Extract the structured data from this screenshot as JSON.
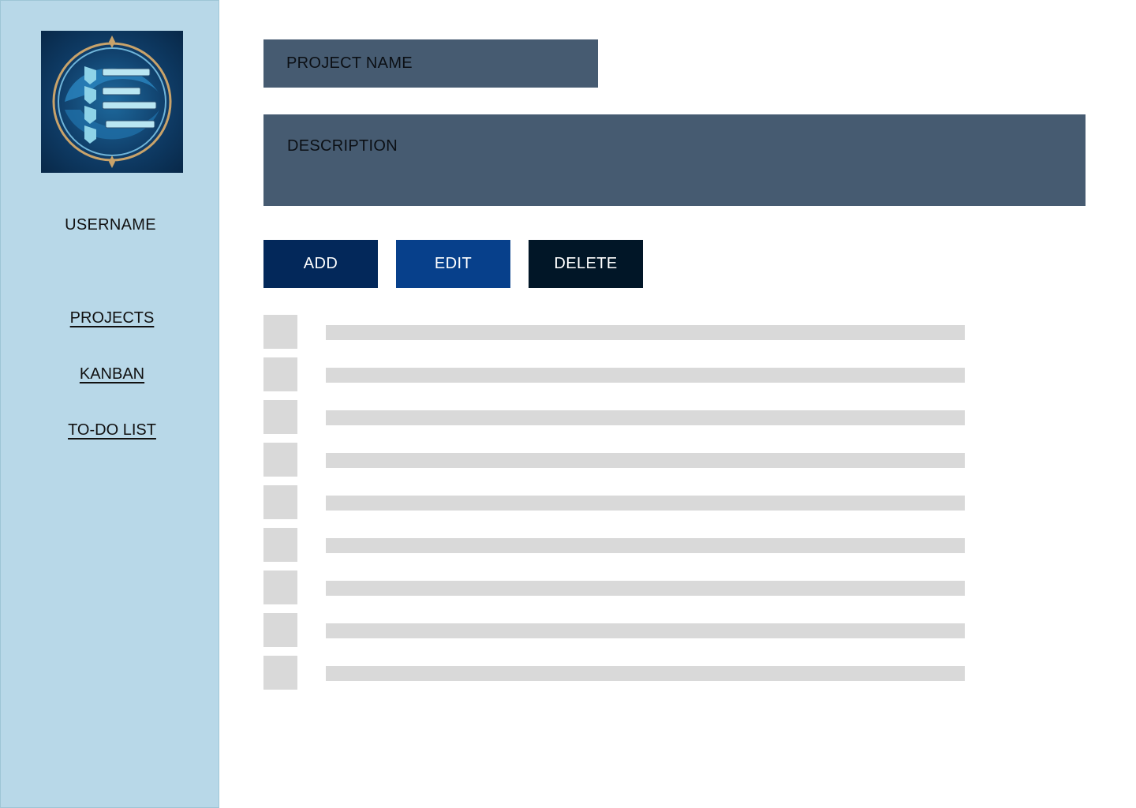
{
  "sidebar": {
    "logo": "app-logo-checklist-emblem",
    "username": "USERNAME",
    "nav": [
      {
        "label": "PROJECTS"
      },
      {
        "label": "KANBAN"
      },
      {
        "label": "TO-DO LIST"
      }
    ]
  },
  "form": {
    "project_name": "PROJECT NAME",
    "description": "DESCRIPTION"
  },
  "actions": {
    "add": "ADD",
    "edit": "EDIT",
    "delete": "DELETE"
  },
  "colors": {
    "sidebar_bg": "#b8d8e8",
    "field_bg": "#465b71",
    "add_bg": "#03285a",
    "edit_bg": "#07408b",
    "delete_bg": "#011627",
    "placeholder": "#d9d9d9"
  },
  "list": {
    "row_count": 9
  }
}
